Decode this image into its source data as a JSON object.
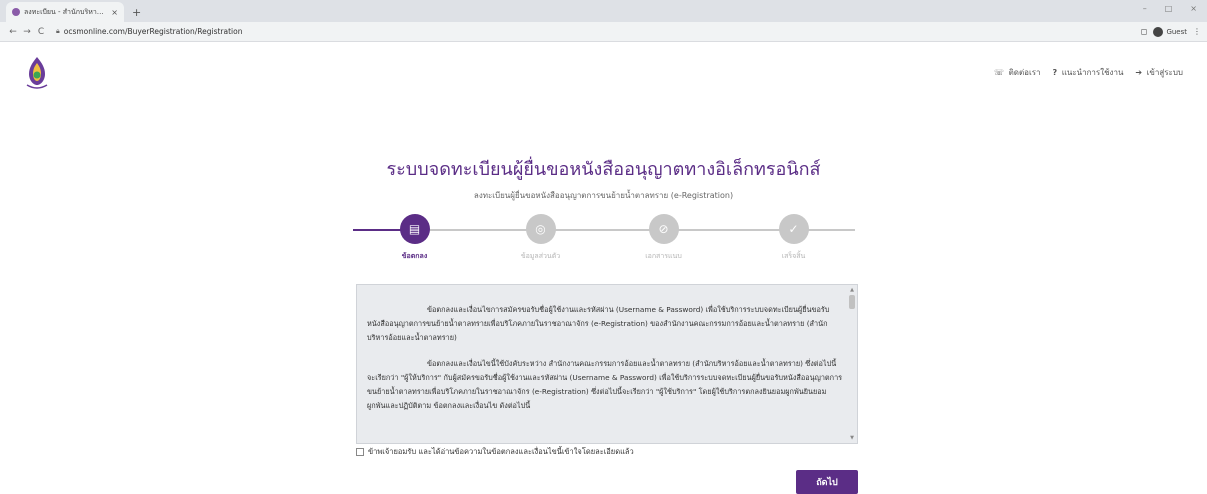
{
  "browser": {
    "tab_title": "ลงทะเบียน - สำนักบริหารอ้อยและน้ำตาล",
    "tab_close": "×",
    "new_tab": "+",
    "url": "ocsmonline.com/BuyerRegistration/Registration",
    "profile_label": "Guest",
    "win_min": "–",
    "win_max": "□",
    "win_close": "×"
  },
  "header": {
    "nav": [
      {
        "icon": "phone-icon",
        "glyph": "☏",
        "label": "ติดต่อเรา"
      },
      {
        "icon": "help-icon",
        "glyph": "?",
        "label": "แนะนำการใช้งาน"
      },
      {
        "icon": "login-icon",
        "glyph": "➔",
        "label": "เข้าสู่ระบบ"
      }
    ]
  },
  "page": {
    "title": "ระบบจดทะเบียนผู้ยื่นขอหนังสืออนุญาตทางอิเล็กทรอนิกส์",
    "subtitle": "ลงทะเบียนผู้ยื่นขอหนังสืออนุญาตการขนย้ายน้ำตาลทราย (e-Registration)"
  },
  "stepper": {
    "steps": [
      {
        "label": "ข้อตกลง",
        "icon": "clipboard-icon",
        "glyph": "▤",
        "active": true
      },
      {
        "label": "ข้อมูลส่วนตัว",
        "icon": "user-icon",
        "glyph": "◎",
        "active": false
      },
      {
        "label": "เอกสารแนบ",
        "icon": "paperclip-icon",
        "glyph": "⊘",
        "active": false
      },
      {
        "label": "เสร็จสิ้น",
        "icon": "check-icon",
        "glyph": "✓",
        "active": false
      }
    ],
    "active_color": "#5b2d86",
    "inactive_color": "#c8c8c8"
  },
  "terms": {
    "paragraphs": [
      "ข้อตกลงและเงื่อนไขการสมัครขอรับชื่อผู้ใช้งานและรหัสผ่าน (Username & Password) เพื่อใช้บริการระบบจดทะเบียนผู้ยื่นขอรับหนังสืออนุญาตการขนย้ายน้ำตาลทรายเพื่อบริโภคภายในราชอาณาจักร (e-Registration) ของสำนักงานคณะกรรมการอ้อยและน้ำตาลทราย (สำนักบริหารอ้อยและน้ำตาลทราย)",
      "ข้อตกลงและเงื่อนไขนี้ใช้บังคับระหว่าง สำนักงานคณะกรรมการอ้อยและน้ำตาลทราย (สำนักบริหารอ้อยและน้ำตาลทราย) ซึ่งต่อไปนี้จะเรียกว่า \"ผู้ให้บริการ\" กับผู้สมัครขอรับชื่อผู้ใช้งานและรหัสผ่าน (Username & Password) เพื่อใช้บริการระบบจดทะเบียนผู้ยื่นขอรับหนังสืออนุญาตการขนย้ายน้ำตาลทรายเพื่อบริโภคภายในราชอาณาจักร (e-Registration) ซึ่งต่อไปนี้จะเรียกว่า \"ผู้ใช้บริการ\" โดยผู้ใช้บริการตกลงยินยอมผูกพันยินยอมผูกพันและปฏิบัติตาม ข้อตกลงและเงื่อนไข ดังต่อไปนี้"
    ]
  },
  "agree": {
    "label": "ข้าพเจ้ายอมรับ และได้อ่านข้อความในข้อตกลงและเงื่อนไขนี้เข้าใจโดยละเอียดแล้ว"
  },
  "actions": {
    "next_label": "ถัดไป"
  }
}
